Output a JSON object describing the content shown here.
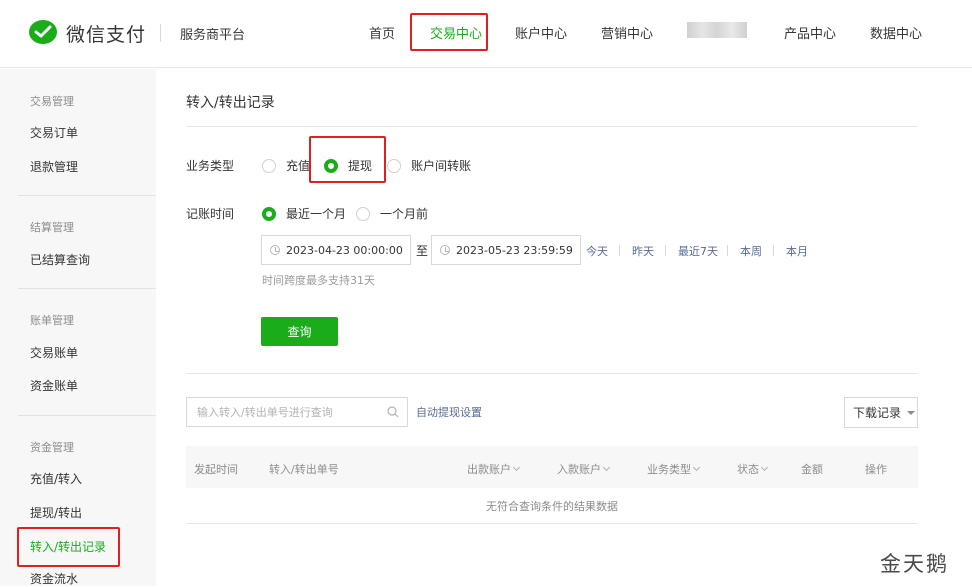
{
  "header": {
    "logo_text": "微信支付",
    "platform": "服务商平台",
    "nav": [
      "首页",
      "交易中心",
      "账户中心",
      "营销中心",
      "产品中心",
      "数据中心"
    ]
  },
  "sidebar": {
    "groups": [
      {
        "title": "交易管理",
        "items": [
          "交易订单",
          "退款管理"
        ]
      },
      {
        "title": "结算管理",
        "items": [
          "已结算查询"
        ]
      },
      {
        "title": "账单管理",
        "items": [
          "交易账单",
          "资金账单"
        ]
      },
      {
        "title": "资金管理",
        "items": [
          "充值/转入",
          "提现/转出",
          "转入/转出记录",
          "资金流水"
        ]
      }
    ]
  },
  "main": {
    "title": "转入/转出记录",
    "business_type": {
      "label": "业务类型",
      "options": [
        "充值",
        "提现",
        "账户间转账"
      ],
      "selected": "提现"
    },
    "record_time": {
      "label": "记账时间",
      "options": [
        "最近一个月",
        "一个月前"
      ],
      "selected": "最近一个月"
    },
    "date_start": "2023-04-23 00:00:00",
    "date_to": "至",
    "date_end": "2023-05-23 23:59:59",
    "quick_ranges": [
      "今天",
      "昨天",
      "最近7天",
      "本周",
      "本月"
    ],
    "hint": "时间跨度最多支持31天",
    "query_button": "查询",
    "search_placeholder": "输入转入/转出单号进行查询",
    "auto_withdraw_link": "自动提现设置",
    "download_button": "下载记录",
    "table_headers": [
      "发起时间",
      "转入/转出单号",
      "出款账户",
      "入款账户",
      "业务类型",
      "状态",
      "金额",
      "操作"
    ],
    "empty_text": "无符合查询条件的结果数据"
  },
  "watermark": "金天鹅",
  "colors": {
    "brand_green": "#1aad19",
    "link_blue": "#576b95",
    "highlight_red": "#e02020"
  }
}
